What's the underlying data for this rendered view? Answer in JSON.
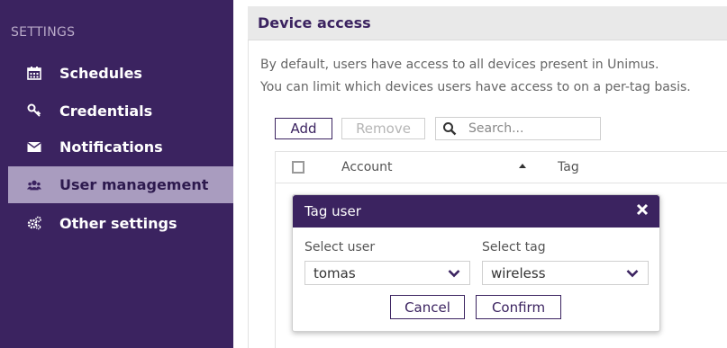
{
  "sidebar": {
    "heading": "SETTINGS",
    "items": [
      {
        "label": "Schedules",
        "icon": "calendar-icon"
      },
      {
        "label": "Credentials",
        "icon": "key-icon"
      },
      {
        "label": "Notifications",
        "icon": "envelope-icon"
      },
      {
        "label": "User management",
        "icon": "users-icon",
        "active": true
      },
      {
        "label": "Other settings",
        "icon": "gears-icon"
      }
    ]
  },
  "panel": {
    "title": "Device access",
    "description_line1": "By default, users have access to all devices present in Unimus.",
    "description_line2": "You can limit which devices users have access to on a per-tag basis."
  },
  "toolbar": {
    "add_label": "Add",
    "remove_label": "Remove",
    "search_placeholder": "Search..."
  },
  "table": {
    "columns": [
      "Account",
      "Tag"
    ],
    "sorted_column": "Account",
    "sort_direction": "ascending"
  },
  "modal": {
    "title": "Tag user",
    "user_label": "Select user",
    "user_value": "tomas",
    "tag_label": "Select tag",
    "tag_value": "wireless",
    "cancel_label": "Cancel",
    "confirm_label": "Confirm"
  },
  "colors": {
    "brand": "#3b2360",
    "active_item_bg": "#a99cbf",
    "header_bg": "#e9e9e9"
  }
}
